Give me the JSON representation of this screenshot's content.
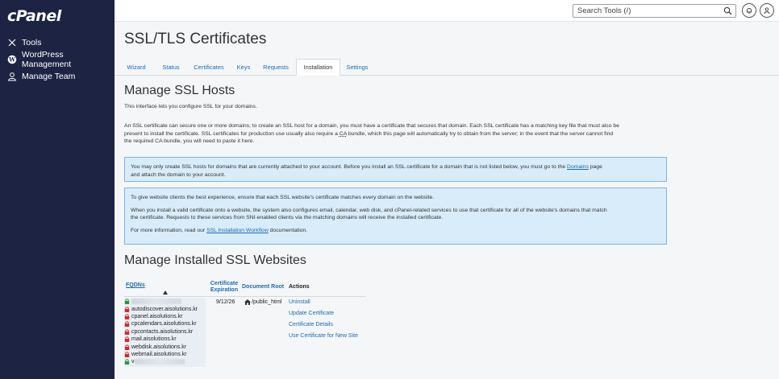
{
  "brand": {
    "logo": "cPanel"
  },
  "sidebar": {
    "items": [
      {
        "label": "Tools",
        "icon": "tools-icon"
      },
      {
        "label": "WordPress Management",
        "icon": "wordpress-icon"
      },
      {
        "label": "Manage Team",
        "icon": "team-icon"
      }
    ]
  },
  "header": {
    "search_placeholder": "Search Tools (/)"
  },
  "page": {
    "title": "SSL/TLS Certificates"
  },
  "tabs": [
    "Wizard",
    "Status",
    "Certificates",
    "Keys",
    "Requests",
    "Installation",
    "Settings"
  ],
  "active_tab": "Installation",
  "manage_hosts": {
    "title": "Manage SSL Hosts",
    "intro": "This interface lets you configure SSL for your domains.",
    "para1": "An SSL certificate can secure one or more domains; to create an SSL host for a domain, you must have a certificate that secures that domain. Each SSL certificate has a matching key file that must also be",
    "para2a": "present to install the certificate. SSL certificates for production use usually also require a ",
    "para2_ca": "CA",
    "para2b": " bundle, which this page will automatically try to obtain from the server; in the event that the server cannot find",
    "para3": "the required CA bundle, you will need to paste it here."
  },
  "info1": {
    "line1a": "You may only create SSL hosts for domains that are currently attached to your account. Before you install an SSL certificate for a domain that is not listed below, you must go to the ",
    "domains_link": "Domains",
    "line1b": " page",
    "line2": "and attach the domain to your account."
  },
  "info2": {
    "line1": "To give website clients the best experience, ensure that each SSL website's certificate matches every domain on the website.",
    "line2": "When you install a valid certificate onto a website, the system also configures email, calendar, web disk, and cPanel-related services to use that certificate for all of the website's domains that match",
    "line3": "the certificate. Requests to these services from SNI-enabled clients via the matching domains will receive the installed certificate.",
    "line4a": "For more information, read our ",
    "workflow_link": "SSL Installation Workflow",
    "line4b": " documentation."
  },
  "installed": {
    "title": "Manage Installed SSL Websites",
    "columns": {
      "fqdns": "FQDNs",
      "cert_exp_1": "Certificate",
      "cert_exp_2": "Expiration",
      "doc_root": "Document Root",
      "actions": "Actions"
    },
    "row": {
      "fqdns": [
        {
          "name": "",
          "lock": "green",
          "blurred": true
        },
        {
          "name": "autodiscover.aisolutions.kr",
          "lock": "red"
        },
        {
          "name": "cpanel.aisolutions.kr",
          "lock": "red"
        },
        {
          "name": "cpcalendars.aisolutions.kr",
          "lock": "red"
        },
        {
          "name": "cpcontacts.aisolutions.kr",
          "lock": "red"
        },
        {
          "name": "mail.aisolutions.kr",
          "lock": "red"
        },
        {
          "name": "webdisk.aisolutions.kr",
          "lock": "red"
        },
        {
          "name": "webmail.aisolutions.kr",
          "lock": "red"
        },
        {
          "name": "v",
          "lock": "green",
          "blurred": true
        }
      ],
      "expiration": "9/12/26",
      "doc_root": "/public_html",
      "actions": [
        "Uninstall",
        "Update Certificate",
        "Certificate Details",
        "Use Certificate for New Site"
      ]
    }
  },
  "colors": {
    "sidebar": "#1d2343",
    "link": "#1a6cb5",
    "info_bg": "#d8ecf9",
    "lock_green": "#1e9b3b",
    "lock_red": "#d9262c"
  }
}
